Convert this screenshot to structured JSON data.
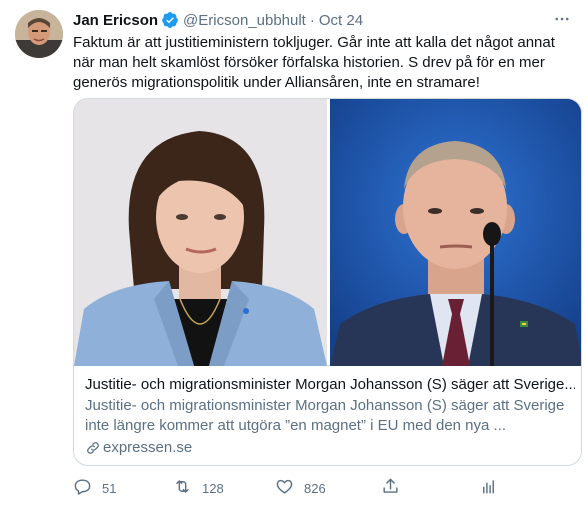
{
  "tweet": {
    "author_name": "Jan Ericson",
    "handle": "@Ericson_ubbhult",
    "separator": "·",
    "date": "Oct 24",
    "text": "Faktum är att justitieministern tokljuger. Går inte att kalla det något annat när man helt skamlöst försöker förfalska historien. S drev på för en mer generös migrationspolitik under Alliansåren, inte en stramare!"
  },
  "card": {
    "title": "Justitie- och migrationsminister Morgan Johansson (S) säger att Sverige...",
    "description": "Justitie- och migrationsminister Morgan Johansson (S) säger att Sverige inte längre kommer att utgöra ”en magnet” i EU med den nya ...",
    "domain": "expressen.se"
  },
  "actions": {
    "reply_count": "51",
    "retweet_count": "128",
    "like_count": "826"
  },
  "icons": {
    "verified": "verified-badge-icon",
    "more": "more-icon",
    "link": "link-icon",
    "reply": "reply-icon",
    "retweet": "retweet-icon",
    "like": "like-icon",
    "share": "share-icon",
    "analytics": "analytics-icon"
  },
  "colors": {
    "accent": "#1d9bf0",
    "secondary_text": "#5b7083",
    "border": "#cfd9de"
  }
}
